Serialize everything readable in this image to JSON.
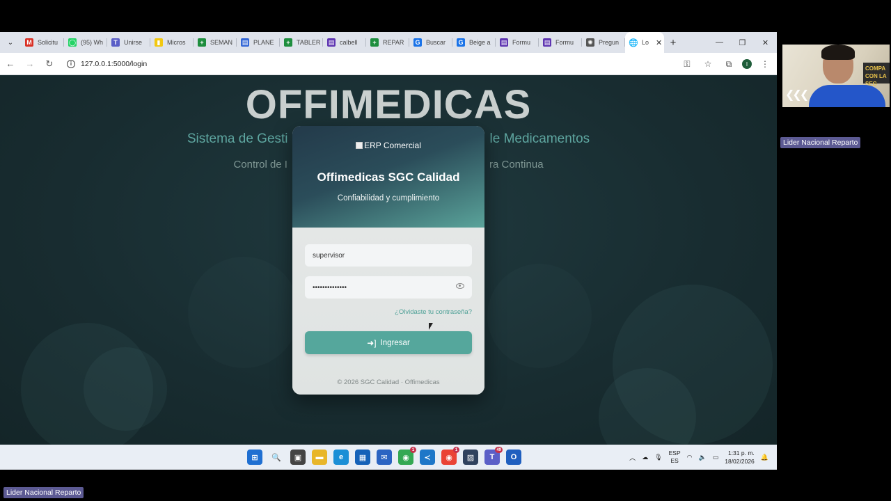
{
  "browser": {
    "tabs": [
      {
        "label": "Solicitu",
        "icon": "gmail-icon",
        "color": "#d93025",
        "glyph": "M"
      },
      {
        "label": "(95) Wh",
        "icon": "whatsapp-icon",
        "color": "#25d366",
        "glyph": "◯"
      },
      {
        "label": "Unirse",
        "icon": "teams-icon",
        "color": "#5b5fc7",
        "glyph": "T"
      },
      {
        "label": "Micros",
        "icon": "powerbi-icon",
        "color": "#f2c811",
        "glyph": "▮"
      },
      {
        "label": "SEMAN",
        "icon": "sheets-plus-icon",
        "color": "#1e8e3e",
        "glyph": "+"
      },
      {
        "label": "PLANE",
        "icon": "chat-icon",
        "color": "#3367d6",
        "glyph": "▤"
      },
      {
        "label": "TABLER",
        "icon": "sheets-plus-icon",
        "color": "#1e8e3e",
        "glyph": "+"
      },
      {
        "label": "calbell",
        "icon": "forms-icon",
        "color": "#5e35b1",
        "glyph": "▤"
      },
      {
        "label": "REPAR",
        "icon": "sheets-plus-icon",
        "color": "#1e8e3e",
        "glyph": "+"
      },
      {
        "label": "Buscar",
        "icon": "chrome-icon",
        "color": "#1a73e8",
        "glyph": "G"
      },
      {
        "label": "Beige a",
        "icon": "chrome-icon",
        "color": "#1a73e8",
        "glyph": "G"
      },
      {
        "label": "Formu",
        "icon": "forms-icon",
        "color": "#5e35b1",
        "glyph": "▤"
      },
      {
        "label": "Formu",
        "icon": "forms-icon",
        "color": "#5e35b1",
        "glyph": "▤"
      },
      {
        "label": "Pregun",
        "icon": "openai-icon",
        "color": "#555555",
        "glyph": "✺"
      }
    ],
    "active_tab": {
      "label": "Lo",
      "icon": "globe-icon"
    },
    "url": "127.0.0.1:5000/login"
  },
  "page": {
    "hero_title": "OFFIMEDICAS",
    "hero_subtitle_left": "Sistema de Gesti",
    "hero_subtitle_right": "le Medicamentos",
    "hero_line2_left": "Control de I",
    "hero_line2_right": "ra Continua"
  },
  "card": {
    "logo_alt": "ERP Comercial",
    "title": "Offimedicas SGC Calidad",
    "tagline": "Confiabilidad y cumplimiento",
    "username_value": "supervisor",
    "password_value": "••••••••••••••",
    "forgot_label": "¿Olvidaste tu contraseña?",
    "submit_label": "Ingresar",
    "copyright": "© 2026 SGC Calidad · Offimedicas"
  },
  "taskbar": {
    "lang_top": "ESP",
    "lang_bottom": "ES",
    "time": "1:31 p. m.",
    "date": "18/02/2026",
    "icons": [
      {
        "name": "windows-start-icon",
        "color": "#1f6fd1",
        "glyph": "⊞"
      },
      {
        "name": "search-icon",
        "color": "#e9eef5",
        "glyph": "🔍"
      },
      {
        "name": "task-view-icon",
        "color": "#444444",
        "glyph": "▣"
      },
      {
        "name": "file-explorer-icon",
        "color": "#e8b62a",
        "glyph": "▬"
      },
      {
        "name": "edge-icon",
        "color": "#1b8fd6",
        "glyph": "e"
      },
      {
        "name": "store-icon",
        "color": "#1562b8",
        "glyph": "▦"
      },
      {
        "name": "outlook-new-icon",
        "color": "#2b64c2",
        "glyph": "✉"
      },
      {
        "name": "chrome-icon",
        "color": "#34a853",
        "glyph": "◉",
        "badge": "1"
      },
      {
        "name": "vscode-icon",
        "color": "#1e77c8",
        "glyph": "≺"
      },
      {
        "name": "chrome-profile-icon",
        "color": "#ea4335",
        "glyph": "◉",
        "badge": "1"
      },
      {
        "name": "terminal-icon",
        "color": "#30425e",
        "glyph": "▨"
      },
      {
        "name": "teams-icon",
        "color": "#5b5fc7",
        "glyph": "T",
        "badge": "49"
      },
      {
        "name": "outlook-icon",
        "color": "#1f5fbf",
        "glyph": "O"
      }
    ]
  },
  "meeting": {
    "participant_name": "Lider Nacional Reparto",
    "self_name": "Lider Nacional Reparto",
    "banner_text": "COMPA CON LA SEG"
  }
}
